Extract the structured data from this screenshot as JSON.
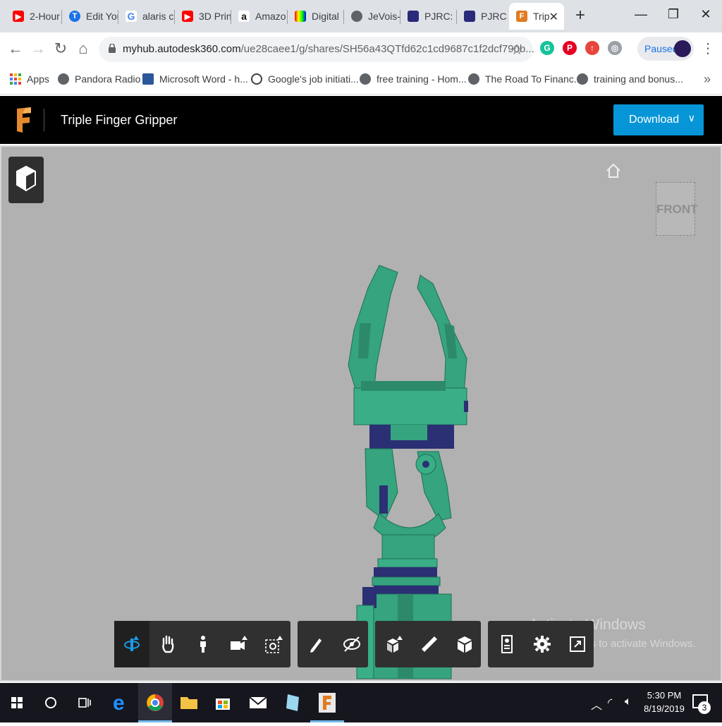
{
  "browser": {
    "tabs": [
      {
        "label": "2-Hour",
        "favicon": "youtube-icon",
        "color": "#ff0000"
      },
      {
        "label": "Edit You",
        "favicon": "edit-icon",
        "color": "#1a73e8"
      },
      {
        "label": "alaris c",
        "favicon": "google-icon",
        "color": "#4285f4"
      },
      {
        "label": "3D Prin",
        "favicon": "youtube-icon",
        "color": "#ff0000"
      },
      {
        "label": "Amazo",
        "favicon": "amazon-icon",
        "color": "#111111"
      },
      {
        "label": "Digital",
        "favicon": "tv-icon",
        "color": "#333333"
      },
      {
        "label": "JeVois-",
        "favicon": "globe-icon",
        "color": "#5f6368"
      },
      {
        "label": "PJRC: E",
        "favicon": "pjrc-icon",
        "color": "#2a2a7a"
      },
      {
        "label": "PJRC St",
        "favicon": "pjrc-icon",
        "color": "#2a2a7a"
      },
      {
        "label": "Trip",
        "favicon": "fusion-icon",
        "color": "#e07b22",
        "active": true
      }
    ],
    "address": {
      "domain": "myhub.autodesk360.com",
      "path": "/ue28caee1/g/shares/SH56a43QTfd62c1cd9687c1f2dcf790b..."
    },
    "profile_status": "Paused",
    "bookmarks": [
      {
        "label": "Apps",
        "icon": "apps-grid-icon"
      },
      {
        "label": "Pandora Radio",
        "icon": "globe-icon"
      },
      {
        "label": "Microsoft Word - h...",
        "icon": "word-doc-icon"
      },
      {
        "label": "Google's job initiati...",
        "icon": "clock-icon"
      },
      {
        "label": "free training - Hom...",
        "icon": "globe-icon"
      },
      {
        "label": "The Road To Financ...",
        "icon": "globe-icon"
      },
      {
        "label": "training and bonus...",
        "icon": "globe-icon"
      }
    ]
  },
  "app": {
    "title": "Triple Finger Gripper",
    "download_label": "Download",
    "viewcube_face": "FRONT",
    "watermark": {
      "line1": "Activate Windows",
      "line2": "Go to Settings to activate Windows."
    },
    "toolbar_groups": [
      [
        "orbit-icon",
        "pan-hand-icon",
        "first-person-icon",
        "camera-icon",
        "zoom-window-icon"
      ],
      [
        "markup-pen-icon",
        "hide-eye-icon"
      ],
      [
        "explode-icon",
        "measure-ruler-icon",
        "model-browser-icon"
      ],
      [
        "properties-icon",
        "settings-gear-icon",
        "fullscreen-icon"
      ]
    ],
    "colors": {
      "accent": "#0696d7",
      "model_green": "#35a47f",
      "model_navy": "#2b2f73"
    }
  },
  "taskbar": {
    "time": "5:30 PM",
    "date": "8/19/2019",
    "notifications": "3",
    "apps": [
      "start-icon",
      "search-icon",
      "task-view-icon",
      "edge-icon",
      "chrome-icon",
      "file-explorer-icon",
      "store-icon",
      "mail-icon",
      "notepad-icon",
      "fusion-icon"
    ]
  }
}
